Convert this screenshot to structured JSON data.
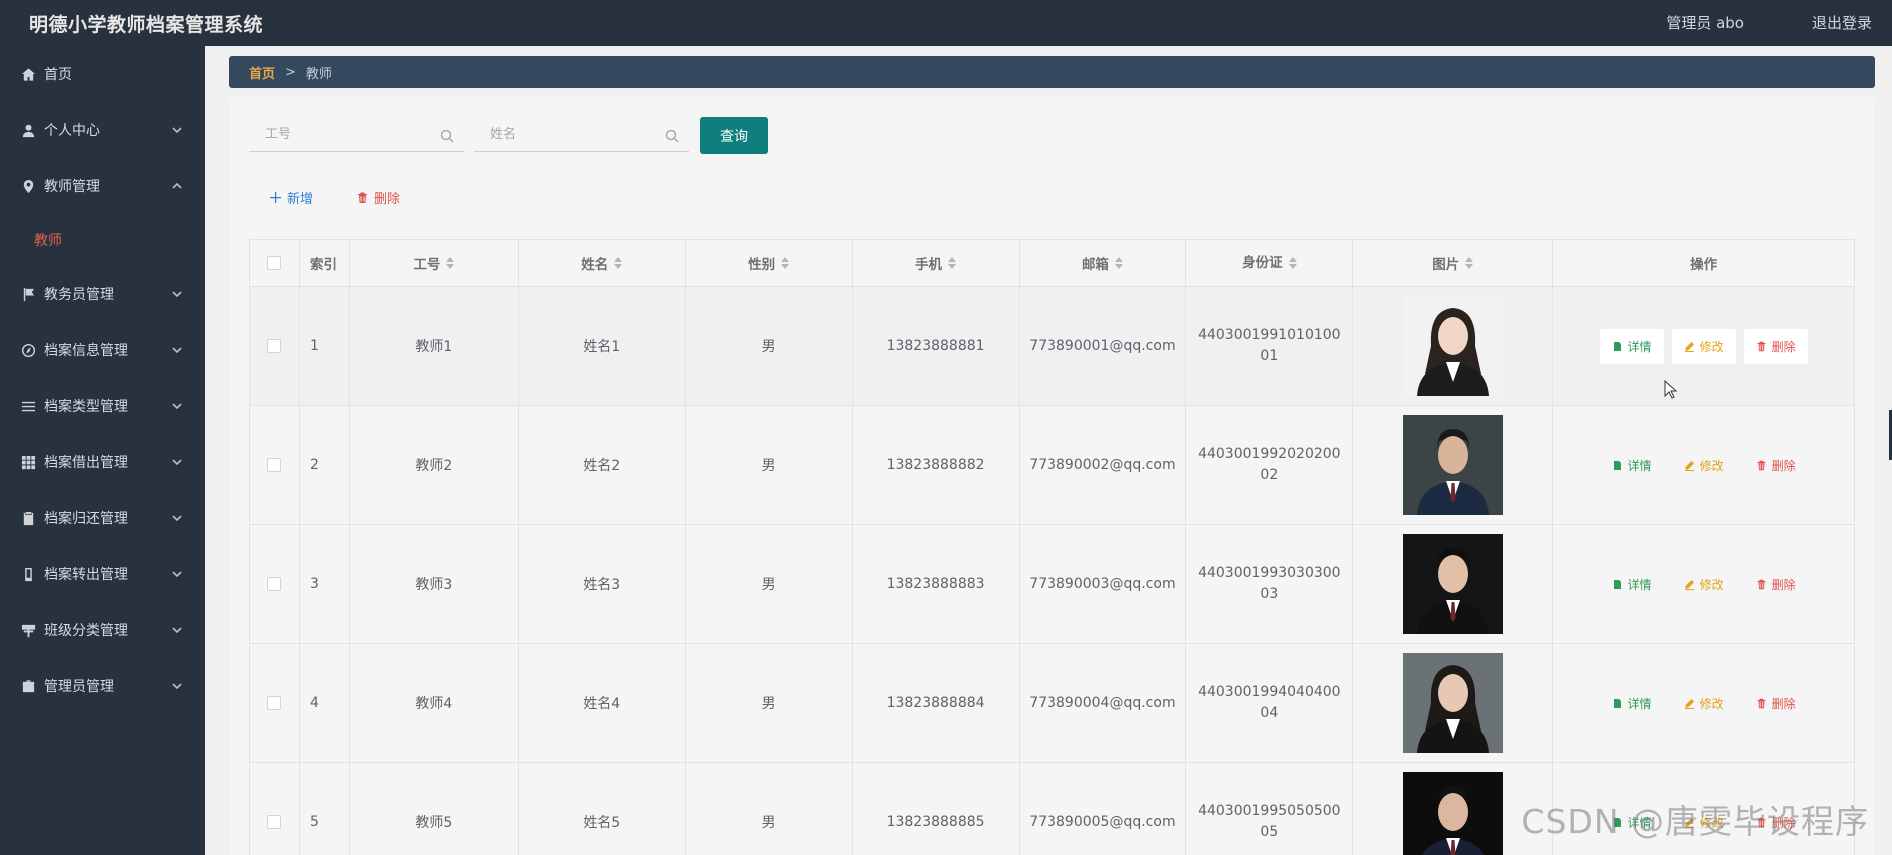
{
  "header": {
    "title": "明德小学教师档案管理系统",
    "user_label": "管理员 abo",
    "logout": "退出登录"
  },
  "sidebar": {
    "items": [
      {
        "label": "首页",
        "icon": "home-icon",
        "has_submenu": false
      },
      {
        "label": "个人中心",
        "icon": "user-icon",
        "has_submenu": true
      },
      {
        "label": "教师管理",
        "icon": "location-icon",
        "has_submenu": true,
        "expanded": true
      },
      {
        "label": "教务员管理",
        "icon": "flag-icon",
        "has_submenu": true
      },
      {
        "label": "档案信息管理",
        "icon": "compass-icon",
        "has_submenu": true
      },
      {
        "label": "档案类型管理",
        "icon": "list-icon",
        "has_submenu": true
      },
      {
        "label": "档案借出管理",
        "icon": "grid-icon",
        "has_submenu": true
      },
      {
        "label": "档案归还管理",
        "icon": "clipboard-icon",
        "has_submenu": true
      },
      {
        "label": "档案转出管理",
        "icon": "mobile-icon",
        "has_submenu": true
      },
      {
        "label": "班级分类管理",
        "icon": "sign-icon",
        "has_submenu": true
      },
      {
        "label": "管理员管理",
        "icon": "briefcase-icon",
        "has_submenu": true
      }
    ],
    "submenu_teacher": "教师"
  },
  "breadcrumb": {
    "home": "首页",
    "separator": ">",
    "current": "教师"
  },
  "search": {
    "gonghao_placeholder": "工号",
    "name_placeholder": "姓名",
    "query_button": "查询"
  },
  "toolbar": {
    "add": "新增",
    "delete": "删除"
  },
  "table": {
    "headers": {
      "index": "索引",
      "gonghao": "工号",
      "name": "姓名",
      "sex": "性别",
      "phone": "手机",
      "email": "邮箱",
      "idcard": "身份证",
      "photo": "图片",
      "actions": "操作"
    },
    "rows": [
      {
        "index": "1",
        "gonghao": "教师1",
        "name": "姓名1",
        "sex": "男",
        "phone": "13823888881",
        "email": "773890001@qq.com",
        "idcard": "440300199101010001"
      },
      {
        "index": "2",
        "gonghao": "教师2",
        "name": "姓名2",
        "sex": "男",
        "phone": "13823888882",
        "email": "773890002@qq.com",
        "idcard": "440300199202020002"
      },
      {
        "index": "3",
        "gonghao": "教师3",
        "name": "姓名3",
        "sex": "男",
        "phone": "13823888883",
        "email": "773890003@qq.com",
        "idcard": "440300199303030003"
      },
      {
        "index": "4",
        "gonghao": "教师4",
        "name": "姓名4",
        "sex": "男",
        "phone": "13823888884",
        "email": "773890004@qq.com",
        "idcard": "440300199404040004"
      },
      {
        "index": "5",
        "gonghao": "教师5",
        "name": "姓名5",
        "sex": "男",
        "phone": "13823888885",
        "email": "773890005@qq.com",
        "idcard": "440300199505050005"
      }
    ],
    "actions": {
      "detail": "详情",
      "edit": "修改",
      "delete": "删除"
    }
  },
  "watermark": "CSDN @唐雯毕设程序",
  "colors": {
    "sidebar_bg": "#28323f",
    "breadcrumb_bg": "#34495e",
    "query_button": "#0e7f7c",
    "active_submenu": "#e0614d",
    "detail": "#2e9b58",
    "edit": "#e3a41b",
    "delete": "#e0534b",
    "add": "#2d7ed6"
  }
}
